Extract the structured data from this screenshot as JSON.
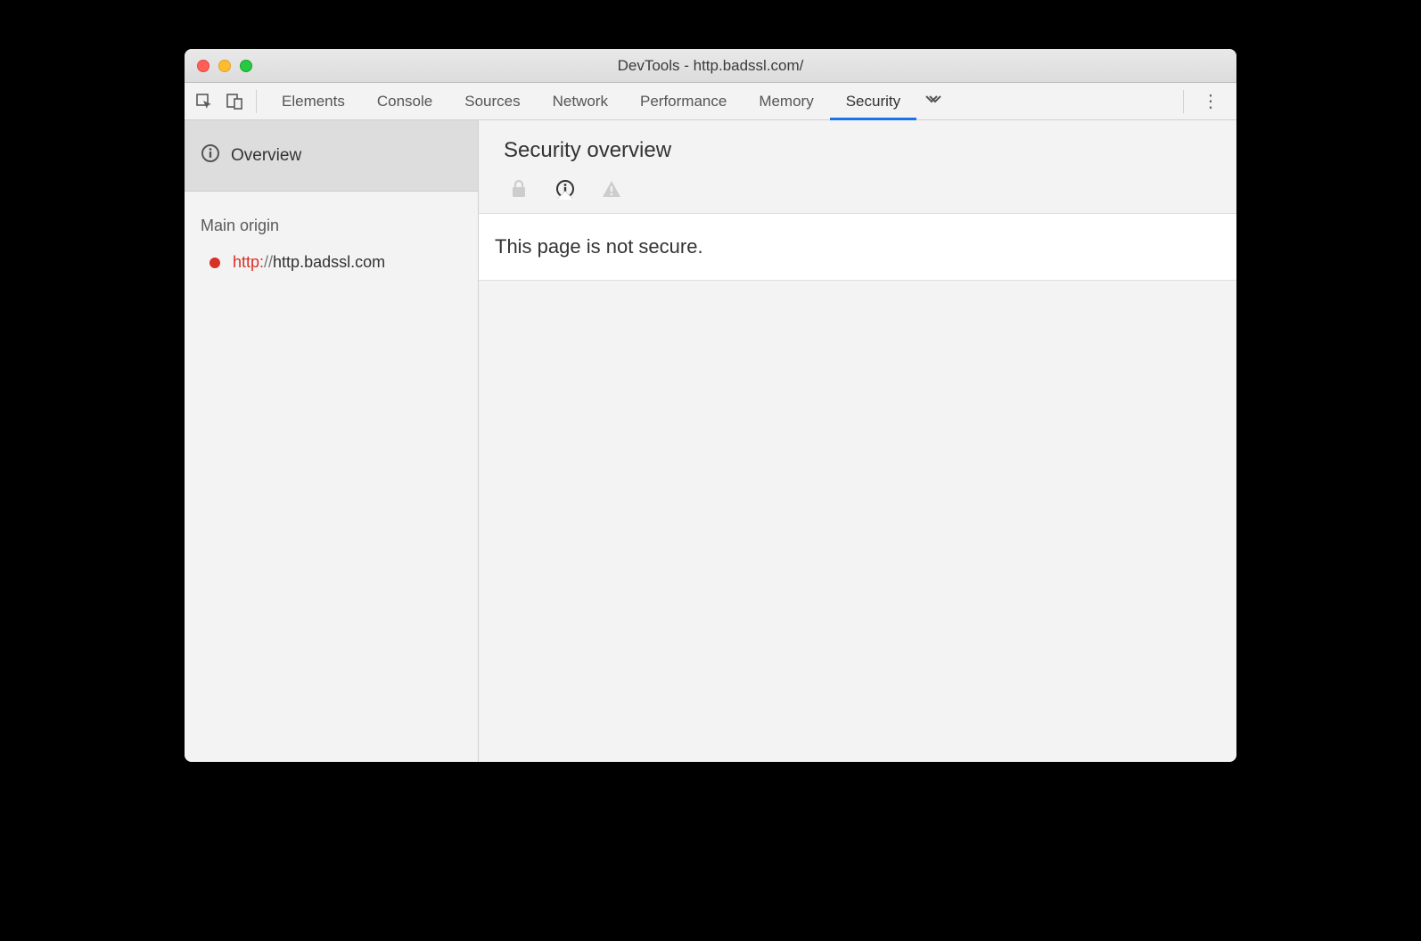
{
  "window": {
    "title": "DevTools - http.badssl.com/"
  },
  "toolbar": {
    "tabs": [
      {
        "label": "Elements"
      },
      {
        "label": "Console"
      },
      {
        "label": "Sources"
      },
      {
        "label": "Network"
      },
      {
        "label": "Performance"
      },
      {
        "label": "Memory"
      },
      {
        "label": "Security"
      }
    ],
    "active_tab_index": 6
  },
  "sidebar": {
    "overview_label": "Overview",
    "section_label": "Main origin",
    "origins": [
      {
        "scheme": "http:",
        "separator": "//",
        "host": "http.badssl.com",
        "status_color": "#d93025"
      }
    ]
  },
  "panel": {
    "title": "Security overview",
    "icons": [
      {
        "name": "lock-icon",
        "active": false
      },
      {
        "name": "info-icon",
        "active": true
      },
      {
        "name": "warning-triangle-icon",
        "active": false
      }
    ],
    "message": "This page is not secure."
  }
}
